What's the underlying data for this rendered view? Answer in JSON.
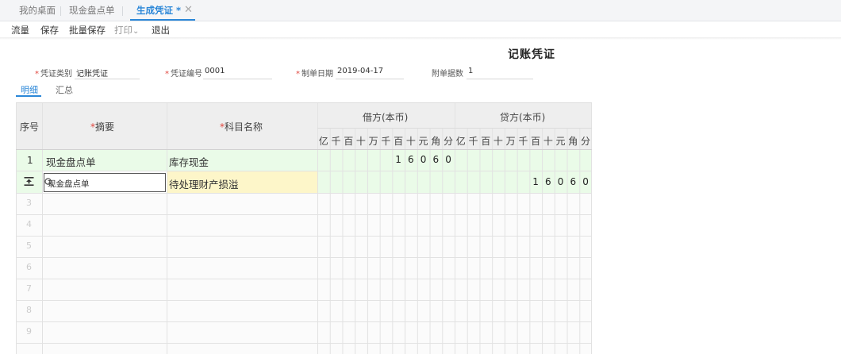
{
  "tabs": [
    {
      "label": "我的桌面",
      "active": false
    },
    {
      "label": "现金盘点单",
      "active": false
    },
    {
      "label": "生成凭证 *",
      "active": true
    }
  ],
  "toolbar": {
    "items": [
      "流量",
      "保存",
      "批量保存",
      "打印",
      "退出"
    ],
    "print_arrow": "⌄"
  },
  "voucher": {
    "title": "记账凭证",
    "fields": {
      "type_label": "凭证类别",
      "type_value": "记账凭证",
      "number_label": "凭证编号",
      "number_value": "0001",
      "date_label": "制单日期",
      "date_value": "2019-04-17",
      "attach_label": "附单据数",
      "attach_value": "1"
    }
  },
  "subtabs": [
    "明细",
    "汇总"
  ],
  "grid": {
    "headers": {
      "seq": "序号",
      "summary": "摘要",
      "account": "科目名称",
      "debit": "借方(本币)",
      "credit": "贷方(本币)"
    },
    "digit_units": [
      "亿",
      "千",
      "百",
      "十",
      "万",
      "千",
      "百",
      "十",
      "元",
      "角",
      "分"
    ],
    "rows": [
      {
        "seq": "1",
        "summary": "现金盘点单",
        "account": "库存现金",
        "debit": "16060",
        "credit": ""
      },
      {
        "seq": "",
        "summary": "现金盘点单",
        "account": "待处理财产损溢",
        "debit": "",
        "credit": "16060"
      }
    ],
    "empty_row_numbers": [
      "3",
      "4",
      "5",
      "6",
      "7",
      "8",
      "9"
    ],
    "colors": {
      "row1_bg": "#eafbe8",
      "row2_account_bg": "#fdf6c9",
      "row2_amount_bg": "#eafbe8",
      "header_bg": "#eeeeee"
    }
  }
}
